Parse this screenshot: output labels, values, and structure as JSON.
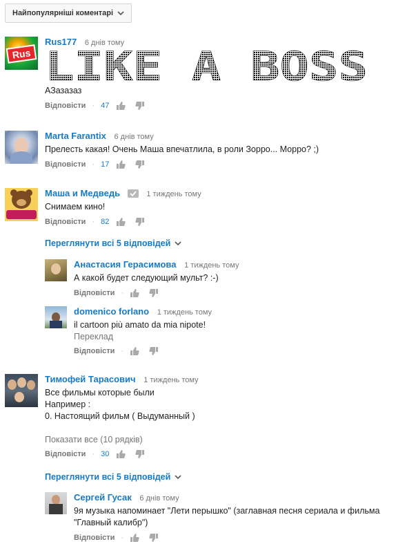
{
  "sort": {
    "label": "Найпопулярніші коментарі"
  },
  "comments": [
    {
      "author": "Rus177",
      "time": "6 днів тому",
      "image_text": "LIKE A BOSS",
      "text": "АЗазазаз",
      "reply_label": "Відповісти",
      "likes": "47",
      "avatar_text": "Rus"
    },
    {
      "author": "Marta Farantix",
      "time": "6 днів тому",
      "text": "Прелесть какая! Очень Маша впечатлила, в роли Зорро... Морро? ;)",
      "reply_label": "Відповісти",
      "likes": "17"
    },
    {
      "author": "Маша и Медведь",
      "time": "1 тиждень тому",
      "text": "Снимаем кино!",
      "reply_label": "Відповісти",
      "likes": "82",
      "show_replies": "Переглянути всі 5 відповідей",
      "replies": [
        {
          "author": "Анастасия Герасимова",
          "time": "1 тиждень тому",
          "text": "А какой будет следующий мульт? :-)",
          "reply_label": "Відповісти"
        },
        {
          "author": "domenico forlano",
          "time": "1 тиждень тому",
          "text": "il cartoon più amato da mia nipote!",
          "translate": "Переклад",
          "reply_label": "Відповісти"
        }
      ]
    },
    {
      "author": "Тимофей Тарасович",
      "time": "1 тиждень тому",
      "lines": [
        "Все фильмы которые были",
        "Например :",
        "0. Настоящий фильм ( Выдуманный )"
      ],
      "show_all": "Показати все (10 рядків)",
      "reply_label": "Відповісти",
      "likes": "30",
      "show_replies": "Переглянути всі 5 відповідей",
      "replies": [
        {
          "author": "Сергей Гусак",
          "time": "6 днів тому",
          "lines": [
            "9я музыка напоминает \"Лети перышко\" (заглавная песня сериала и фильма",
            "\"Главный калибр\")"
          ],
          "reply_label": "Відповісти"
        }
      ]
    }
  ],
  "colors": {
    "link": "#167ac6",
    "muted": "#767676"
  }
}
